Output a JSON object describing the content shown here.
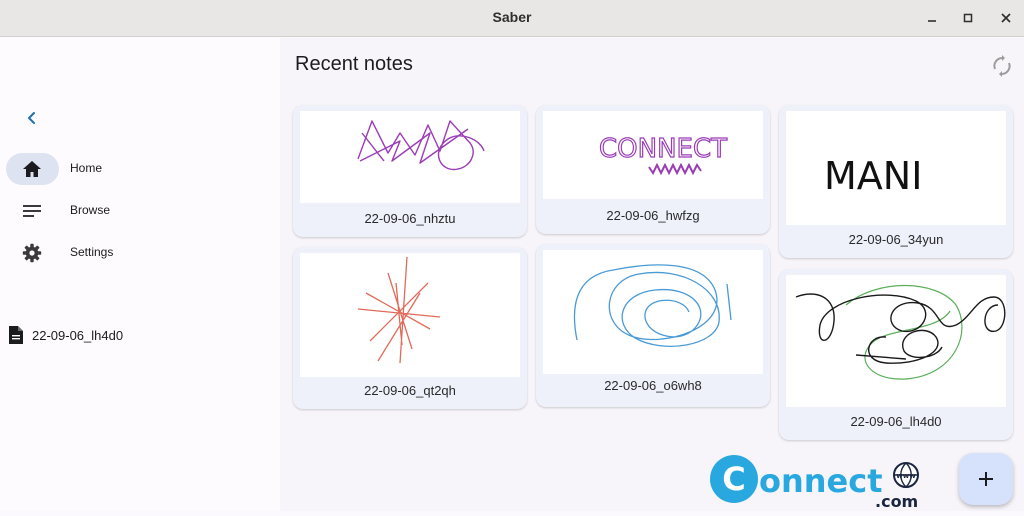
{
  "window": {
    "title": "Saber"
  },
  "sidebar": {
    "items": [
      {
        "label": "Home",
        "icon": "home-icon",
        "active": true
      },
      {
        "label": "Browse",
        "icon": "browse-icon",
        "active": false
      },
      {
        "label": "Settings",
        "icon": "gear-icon",
        "active": false
      }
    ],
    "recent_file": "22-09-06_lh4d0"
  },
  "main": {
    "heading": "Recent notes",
    "notes": [
      {
        "name": "22-09-06_nhztu"
      },
      {
        "name": "22-09-06_hwfzg"
      },
      {
        "name": "22-09-06_34yun"
      },
      {
        "name": "22-09-06_qt2qh"
      },
      {
        "name": "22-09-06_o6wh8"
      },
      {
        "name": "22-09-06_lh4d0"
      }
    ],
    "sketch_text": {
      "hwfzg": "CONNECT",
      "34yun": "MANI"
    }
  },
  "watermark": {
    "text": "onnect",
    "letter": "C",
    "suffix": ".com",
    "www": "www"
  },
  "colors": {
    "accent": "#1f6fb3",
    "fab": "#d6e1fb",
    "active_indicator": "#dde3f0",
    "card": "#eef0fa"
  }
}
